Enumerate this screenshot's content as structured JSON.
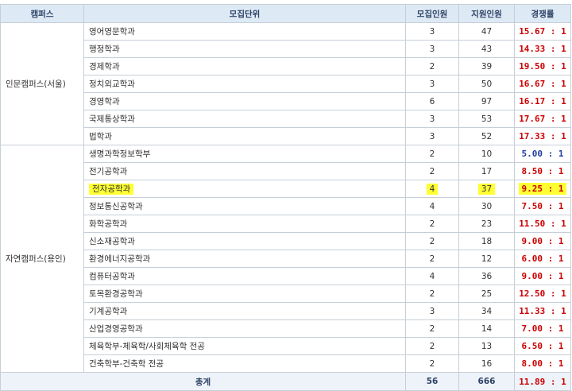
{
  "headers": {
    "campus": "캠퍼스",
    "unit": "모집단위",
    "recruit": "모집인원",
    "applicants": "지원인원",
    "ratio": "경쟁률"
  },
  "colors": {
    "ratio_high": "#cc0000",
    "ratio_low": "#1f3fa0",
    "highlight": "#ffff33"
  },
  "campuses": [
    {
      "name": "인문캠퍼스(서울)",
      "rows": [
        {
          "unit": "영어영문학과",
          "recruit": "3",
          "applicants": "47",
          "ratio": "15.67 : 1",
          "ratio_color": "#cc0000",
          "highlight": false
        },
        {
          "unit": "행정학과",
          "recruit": "3",
          "applicants": "43",
          "ratio": "14.33 : 1",
          "ratio_color": "#cc0000",
          "highlight": false
        },
        {
          "unit": "경제학과",
          "recruit": "2",
          "applicants": "39",
          "ratio": "19.50 : 1",
          "ratio_color": "#cc0000",
          "highlight": false
        },
        {
          "unit": "정치외교학과",
          "recruit": "3",
          "applicants": "50",
          "ratio": "16.67 : 1",
          "ratio_color": "#cc0000",
          "highlight": false
        },
        {
          "unit": "경영학과",
          "recruit": "6",
          "applicants": "97",
          "ratio": "16.17 : 1",
          "ratio_color": "#cc0000",
          "highlight": false
        },
        {
          "unit": "국제통상학과",
          "recruit": "3",
          "applicants": "53",
          "ratio": "17.67 : 1",
          "ratio_color": "#cc0000",
          "highlight": false
        },
        {
          "unit": "법학과",
          "recruit": "3",
          "applicants": "52",
          "ratio": "17.33 : 1",
          "ratio_color": "#cc0000",
          "highlight": false
        }
      ]
    },
    {
      "name": "자연캠퍼스(용인)",
      "rows": [
        {
          "unit": "생명과학정보학부",
          "recruit": "2",
          "applicants": "10",
          "ratio": "5.00 : 1",
          "ratio_color": "#1f3fa0",
          "highlight": false
        },
        {
          "unit": "전기공학과",
          "recruit": "2",
          "applicants": "17",
          "ratio": "8.50 : 1",
          "ratio_color": "#cc0000",
          "highlight": false
        },
        {
          "unit": "전자공학과",
          "recruit": "4",
          "applicants": "37",
          "ratio": "9.25 : 1",
          "ratio_color": "#cc0000",
          "highlight": true
        },
        {
          "unit": "정보통신공학과",
          "recruit": "4",
          "applicants": "30",
          "ratio": "7.50 : 1",
          "ratio_color": "#cc0000",
          "highlight": false
        },
        {
          "unit": "화학공학과",
          "recruit": "2",
          "applicants": "23",
          "ratio": "11.50 : 1",
          "ratio_color": "#cc0000",
          "highlight": false
        },
        {
          "unit": "신소재공학과",
          "recruit": "2",
          "applicants": "18",
          "ratio": "9.00 : 1",
          "ratio_color": "#cc0000",
          "highlight": false
        },
        {
          "unit": "환경에너지공학과",
          "recruit": "2",
          "applicants": "12",
          "ratio": "6.00 : 1",
          "ratio_color": "#cc0000",
          "highlight": false
        },
        {
          "unit": "컴퓨터공학과",
          "recruit": "4",
          "applicants": "36",
          "ratio": "9.00 : 1",
          "ratio_color": "#cc0000",
          "highlight": false
        },
        {
          "unit": "토목환경공학과",
          "recruit": "2",
          "applicants": "25",
          "ratio": "12.50 : 1",
          "ratio_color": "#cc0000",
          "highlight": false
        },
        {
          "unit": "기계공학과",
          "recruit": "3",
          "applicants": "34",
          "ratio": "11.33 : 1",
          "ratio_color": "#cc0000",
          "highlight": false
        },
        {
          "unit": "산업경영공학과",
          "recruit": "2",
          "applicants": "14",
          "ratio": "7.00 : 1",
          "ratio_color": "#cc0000",
          "highlight": false
        },
        {
          "unit": "체육학부-체육학/사회체육학 전공",
          "recruit": "2",
          "applicants": "13",
          "ratio": "6.50 : 1",
          "ratio_color": "#cc0000",
          "highlight": false
        },
        {
          "unit": "건축학부-건축학 전공",
          "recruit": "2",
          "applicants": "16",
          "ratio": "8.00 : 1",
          "ratio_color": "#cc0000",
          "highlight": false
        }
      ]
    }
  ],
  "total": {
    "label": "총계",
    "recruit": "56",
    "applicants": "666",
    "ratio": "11.89 : 1"
  }
}
